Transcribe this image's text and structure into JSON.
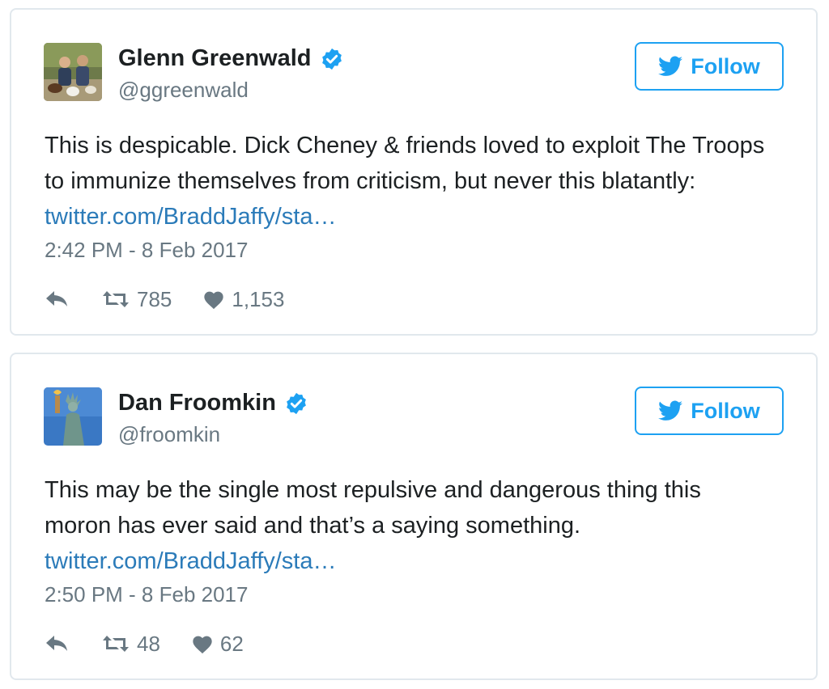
{
  "tweets": [
    {
      "name": "Glenn Greenwald",
      "handle": "@ggreenwald",
      "follow_label": "Follow",
      "text_plain": "This is despicable. Dick Cheney & friends loved to exploit The Troops to immunize themselves from criticism, but never this blatantly: ",
      "link": "twitter.com/BraddJaffy/sta…",
      "time": "2:42 PM - 8 Feb 2017",
      "retweets": "785",
      "likes": "1,153"
    },
    {
      "name": "Dan Froomkin",
      "handle": "@froomkin",
      "follow_label": "Follow",
      "text_plain": "This may be the single most repulsive and dangerous thing this moron has ever said and that’s a saying something. ",
      "link": "twitter.com/BraddJaffy/sta…",
      "time": "2:50 PM - 8 Feb 2017",
      "retweets": "48",
      "likes": "62"
    }
  ],
  "colors": {
    "accent": "#1da1f2",
    "link": "#2b7bb9",
    "muted": "#697882",
    "border": "#e1e8ed"
  },
  "icons": [
    "avatar-photo",
    "verified-badge-icon",
    "twitter-bird-icon",
    "reply-icon",
    "retweet-icon",
    "heart-icon"
  ]
}
